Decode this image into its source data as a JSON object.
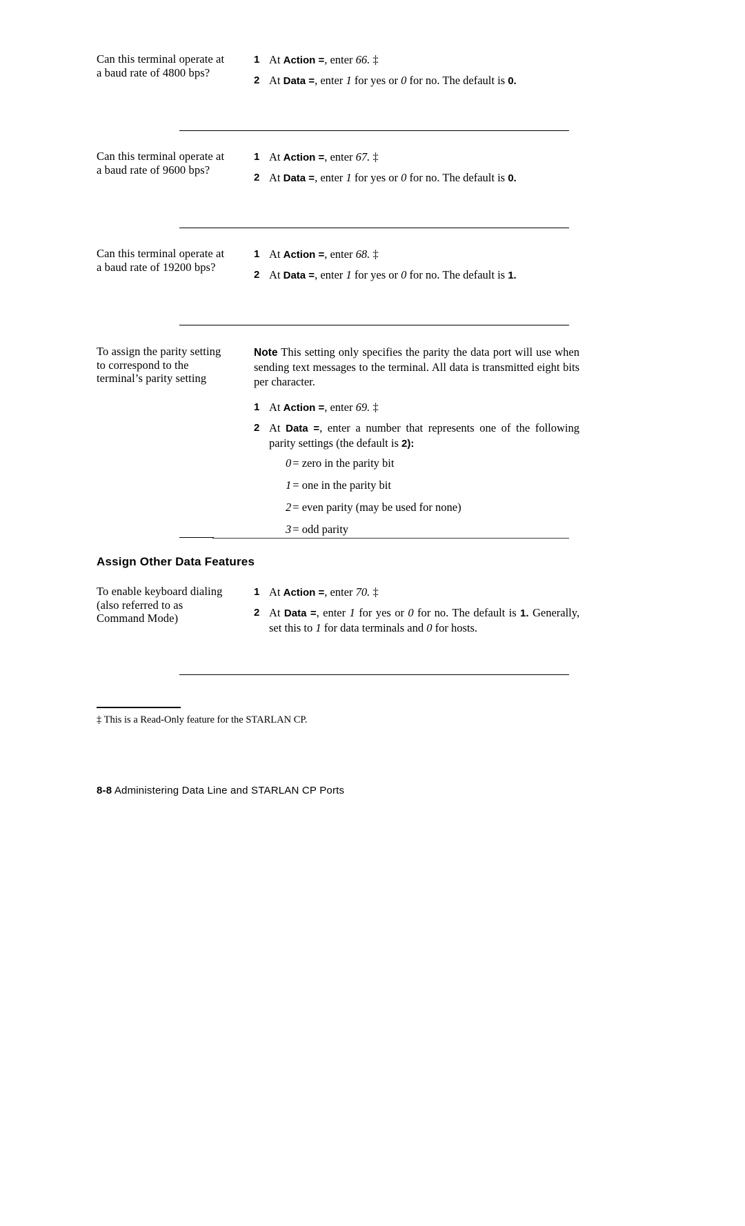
{
  "page": {
    "footnote_marker": "‡",
    "footnote_text": "This is a Read-Only feature for the STARLAN CP.",
    "footer_page": "8-8",
    "footer_title": "Administering Data Line and STARLAN CP Ports"
  },
  "blocks": [
    {
      "id": "baud-4800",
      "prompt": "Can this terminal operate at a baud rate of 4800 bps?",
      "steps": [
        {
          "num": "1",
          "pre": "At",
          "field": "Action =",
          "mid": ", enter",
          "value": "66.",
          "suffix": "‡"
        },
        {
          "num": "2",
          "pre": "At",
          "field": "Data =",
          "mid": ", enter",
          "value": "1",
          "text_a": "for yes or",
          "value_b": "0",
          "text_b": "for no. The default is",
          "default": "0."
        }
      ]
    },
    {
      "id": "baud-9600",
      "prompt": "Can this terminal operate at a baud rate of 9600 bps?",
      "steps": [
        {
          "num": "1",
          "pre": "At",
          "field": "Action =",
          "mid": ", enter",
          "value": "67.",
          "suffix": "‡"
        },
        {
          "num": "2",
          "pre": "At",
          "field": "Data =",
          "mid": ", enter",
          "value": "1",
          "text_a": "for yes or",
          "value_b": "0",
          "text_b": "for no. The default is",
          "default": "0."
        }
      ]
    },
    {
      "id": "baud-19200",
      "prompt": "Can this terminal operate at a baud rate of 19200 bps?",
      "steps": [
        {
          "num": "1",
          "pre": "At",
          "field": "Action =",
          "mid": ", enter",
          "value": "68.",
          "suffix": "‡"
        },
        {
          "num": "2",
          "pre": "At",
          "field": "Data =",
          "mid": ", enter",
          "value": "1",
          "text_a": "for yes or",
          "value_b": "0",
          "text_b": "for no. The default is",
          "default": "1."
        }
      ]
    }
  ],
  "parity": {
    "prompt": "To assign the parity setting to correspond to the terminal’s parity setting",
    "note_label": "Note",
    "note_text": "This setting only specifies the parity the data port will use when sending text messages to the terminal. All data is transmitted eight bits per character.",
    "step1": {
      "num": "1",
      "pre": "At",
      "field": "Action =",
      "mid": ", enter",
      "value": "69.",
      "suffix": "‡"
    },
    "step2": {
      "num": "2",
      "pre": "At",
      "field": "Data =",
      "text_a": ", enter a number that represents one of the following parity settings (the default is",
      "default": "2):"
    },
    "options": [
      {
        "key": "0",
        "eq": "=",
        "desc": "zero in the parity bit"
      },
      {
        "key": "1",
        "eq": "=",
        "desc": "one in the parity bit"
      },
      {
        "key": "2",
        "eq": "=",
        "desc": "even parity (may be used for none)"
      },
      {
        "key": "3",
        "eq": "=",
        "desc": "odd parity"
      }
    ]
  },
  "section": {
    "heading": "Assign Other Data Features"
  },
  "keyboard_dialing": {
    "prompt": "To enable keyboard dialing (also referred to as Command Mode)",
    "step1": {
      "num": "1",
      "pre": "At",
      "field": "Action =",
      "mid": ", enter",
      "value": "70.",
      "suffix": "‡"
    },
    "step2": {
      "num": "2",
      "pre": "At",
      "field": "Data =",
      "mid": ", enter",
      "value": "1",
      "text_a": "for yes or",
      "value_b": "0",
      "text_b": "for no. The default is",
      "default": "1.",
      "text_c": "Generally, set this to",
      "value_c": "1",
      "text_d": "for data terminals and",
      "value_d": "0",
      "text_e": "for hosts."
    }
  }
}
